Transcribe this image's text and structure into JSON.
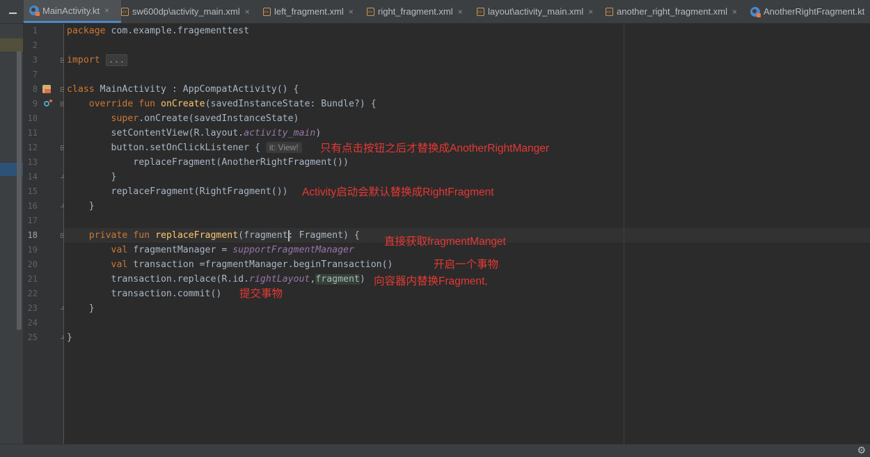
{
  "tabs": [
    {
      "label": "MainActivity.kt",
      "icon": "kotlin-file-icon",
      "active": true
    },
    {
      "label": "sw600dp\\activity_main.xml",
      "icon": "xml-file-icon"
    },
    {
      "label": "left_fragment.xml",
      "icon": "xml-file-icon"
    },
    {
      "label": "right_fragment.xml",
      "icon": "xml-file-icon"
    },
    {
      "label": "layout\\activity_main.xml",
      "icon": "xml-file-icon"
    },
    {
      "label": "another_right_fragment.xml",
      "icon": "xml-file-icon"
    },
    {
      "label": "AnotherRightFragment.kt",
      "icon": "kotlin-file-icon"
    }
  ],
  "tab_close_glyph": "×",
  "line_numbers": [
    "1",
    "2",
    "3",
    "7",
    "8",
    "9",
    "10",
    "11",
    "12",
    "13",
    "14",
    "15",
    "16",
    "17",
    "18",
    "19",
    "20",
    "21",
    "22",
    "23",
    "24",
    "25"
  ],
  "current_line": "18",
  "code": {
    "l1_kw": "package",
    "l1_rest": " com.example.fragementtest",
    "l3_kw": "import",
    "l3_fold": "...",
    "l8_kw": "class",
    "l8_rest": " MainActivity : AppCompatActivity() {",
    "l9_kw1": "override",
    "l9_kw2": "fun",
    "l9_fn": "onCreate",
    "l9_rest": "(savedInstanceState: Bundle?) {",
    "l10_kw": "super",
    "l10_rest": ".onCreate(savedInstanceState)",
    "l11_a": "setContentView(R.layout.",
    "l11_it": "activity_main",
    "l11_b": ")",
    "l12_a": "button.setOnClickListener {",
    "l12_hint": "it: View!",
    "l13": "replaceFragment(AnotherRightFragment())",
    "l14": "}",
    "l15": "replaceFragment(RightFragment())",
    "l16": "}",
    "l18_kw1": "private",
    "l18_kw2": "fun",
    "l18_fn": "replaceFragment",
    "l18_a": "(fragment: Fragment) {",
    "l19_kw": "val",
    "l19_a": " fragmentManager = ",
    "l19_it": "supportFragmentManager",
    "l20_kw": "val",
    "l20_a": " transaction =fragmentManager.beginTransaction()",
    "l21_a": "transaction.replace(R.id.",
    "l21_it": "rightLayout",
    "l21_b": ",",
    "l21_param": "fragment",
    "l21_c": ")",
    "l22": "transaction.commit()",
    "l23": "}",
    "l25": "}"
  },
  "annotations": {
    "a1": "只有点击按钮之后才替换成AnotherRightManger",
    "a2": "Activity启动会默认替换成RightFragment",
    "a3": "直接获取fragmentManget",
    "a4": "开启一个事物",
    "a5": "向容器内替换Fragment,",
    "a6": "提交事物"
  },
  "colors": {
    "background": "#2b2b2b",
    "keyword": "#cc7832",
    "function": "#ffc66d",
    "field": "#9876aa",
    "text": "#a9b7c6",
    "annotation": "#e53935",
    "tab_accent": "#4a88c7"
  }
}
